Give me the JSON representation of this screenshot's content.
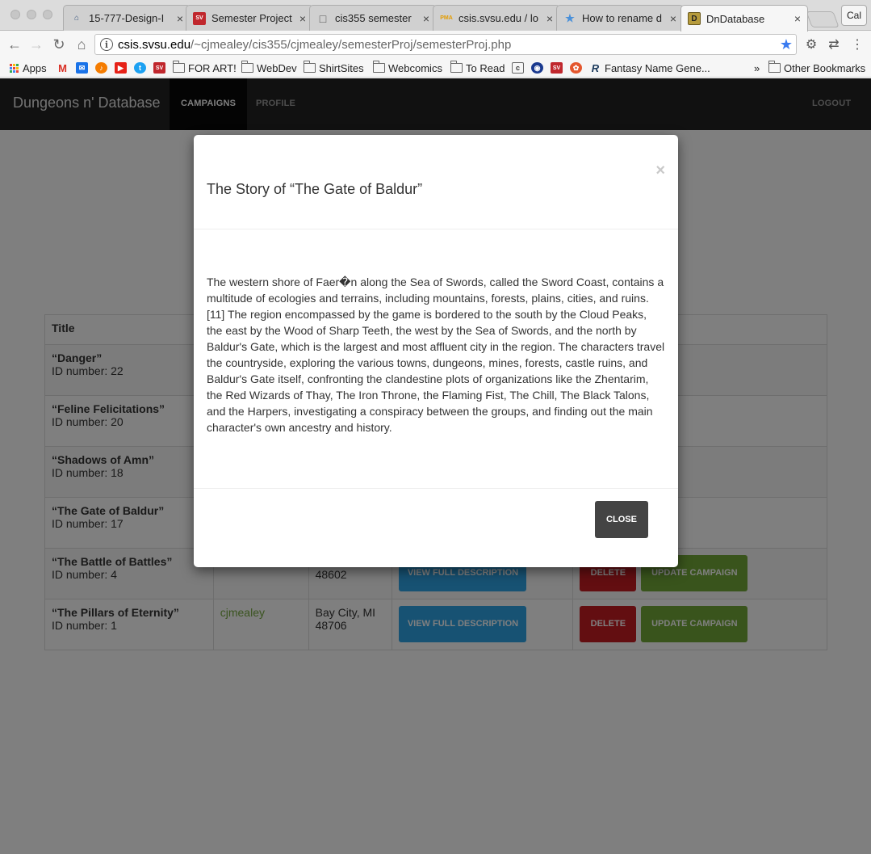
{
  "browser": {
    "tabs": [
      {
        "label": "15-777-Design-I",
        "favicon_color": "#3d5a80",
        "favicon_char": "⌂"
      },
      {
        "label": "Semester Project",
        "favicon_color": "#c0272d",
        "favicon_char": "SV"
      },
      {
        "label": "cis355 semester",
        "favicon_color": "#ffffff",
        "favicon_char": "□"
      },
      {
        "label": "csis.svsu.edu / lo",
        "favicon_color": "#f2a900",
        "favicon_char": "PMA"
      },
      {
        "label": "How to rename d",
        "favicon_color": "#4a90d9",
        "favicon_char": "★"
      },
      {
        "label": "DnDatabase",
        "favicon_color": "#b69b3c",
        "favicon_char": "D"
      }
    ],
    "profile_label": "Cal",
    "url_host": "csis.svsu.edu",
    "url_path": "/~cjmealey/cis355/cjmealey/semesterProj/semesterProj.php",
    "bookmarks": [
      {
        "label": "Apps",
        "type": "apps"
      },
      {
        "label": "",
        "type": "icon",
        "color": "#d93025",
        "char": "M"
      },
      {
        "label": "",
        "type": "icon",
        "color": "#1a73e8",
        "char": "✉"
      },
      {
        "label": "",
        "type": "icon",
        "color": "#f57c00",
        "char": "♪"
      },
      {
        "label": "",
        "type": "icon",
        "color": "#e62117",
        "char": "▶"
      },
      {
        "label": "",
        "type": "icon",
        "color": "#1da1f2",
        "char": "t"
      },
      {
        "label": "",
        "type": "icon",
        "color": "#c0272d",
        "char": "SV"
      },
      {
        "label": "FOR ART!",
        "type": "folder"
      },
      {
        "label": "WebDev",
        "type": "folder"
      },
      {
        "label": "ShirtSites",
        "type": "folder"
      },
      {
        "label": "Webcomics",
        "type": "folder"
      },
      {
        "label": "To Read",
        "type": "folder"
      },
      {
        "label": "",
        "type": "icon",
        "color": "#666666",
        "char": "c"
      },
      {
        "label": "",
        "type": "icon",
        "color": "#1b3a8f",
        "char": "◉"
      },
      {
        "label": "",
        "type": "icon",
        "color": "#c0272d",
        "char": "SV"
      },
      {
        "label": "",
        "type": "icon",
        "color": "#e4572e",
        "char": "✿"
      },
      {
        "label": "Fantasy Name Gene...",
        "type": "icon",
        "color": "#ffffff",
        "char": "R"
      }
    ],
    "overflow_label": "»",
    "other_bookmarks": "Other Bookmarks"
  },
  "navbar": {
    "brand": "Dungeons n' Database",
    "campaigns": "CAMPAIGNS",
    "profile": "PROFILE",
    "logout": "LOGOUT"
  },
  "table": {
    "header_title": "Title",
    "rows": [
      {
        "title": "“Danger”",
        "id": "ID number: 22",
        "creator": "",
        "location1": "",
        "location2": "",
        "show_buttons": false
      },
      {
        "title": "“Feline Felicitations”",
        "id": "ID number: 20",
        "creator": "",
        "location1": "",
        "location2": "",
        "show_buttons": false
      },
      {
        "title": "“Shadows of Amn”",
        "id": "ID number: 18",
        "creator": "",
        "location1": "",
        "location2": "",
        "show_buttons": false
      },
      {
        "title": "“The Gate of Baldur”",
        "id": "ID number: 17",
        "creator": "",
        "location1": "",
        "location2": "",
        "show_buttons": false
      },
      {
        "title": "“The Battle of Battles”",
        "id": "ID number: 4",
        "creator": "",
        "location1": "",
        "location2": "48602",
        "show_buttons": true
      },
      {
        "title": "“The Pillars of Eternity”",
        "id": "ID number: 1",
        "creator": "cjmealey",
        "location1": "Bay City, MI",
        "location2": "48706",
        "show_buttons": true
      }
    ],
    "view_label": "VIEW FULL DESCRIPTION",
    "delete_label": "DELETE",
    "update_label": "UPDATE CAMPAIGN"
  },
  "modal": {
    "title": "The Story of “The Gate of Baldur”",
    "close_x": "×",
    "body": "The western shore of Faer�n along the Sea of Swords, called the Sword Coast, contains a multitude of ecologies and terrains, including mountains, forests, plains, cities, and ruins.[11] The region encompassed by the game is bordered to the south by the Cloud Peaks, the east by the Wood of Sharp Teeth, the west by the Sea of Swords, and the north by Baldur's Gate, which is the largest and most affluent city in the region. The characters travel the countryside, exploring the various towns, dungeons, mines, forests, castle ruins, and Baldur's Gate itself, confronting the clandestine plots of organizations like the Zhentarim, the Red Wizards of Thay, The Iron Throne, the Flaming Fist, The Chill, The Black Talons, and the Harpers, investigating a conspiracy between the groups, and finding out the main character's own ancestry and history.",
    "close_button": "CLOSE"
  }
}
